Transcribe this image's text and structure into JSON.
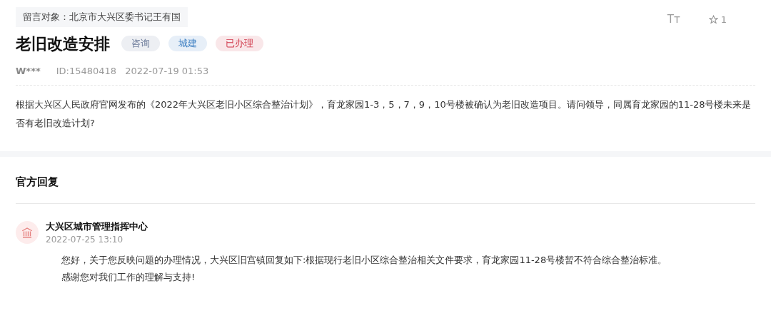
{
  "target": "留言对象：北京市大兴区委书记王有国",
  "toolbar": {
    "font_size": "Tт",
    "star_count": "1"
  },
  "title": "老旧改造安排",
  "tags": [
    {
      "label": "咨询",
      "color": "#6b7a99"
    },
    {
      "label": "城建",
      "color": "#3d7fc2"
    },
    {
      "label": "已办理",
      "color": "#d0384a"
    }
  ],
  "meta": {
    "user": "W***",
    "id": "ID:15480418",
    "time": "2022-07-19 01:53"
  },
  "body": "根据大兴区人民政府官网发布的《2022年大兴区老旧小区综合整治计划》，育龙家园1-3，5，7，9，10号楼被确认为老旧改造项目。请问领导，同属育龙家园的11-28号楼未来是否有老旧改造计划?",
  "reply_section": {
    "heading": "官方回复",
    "replies": [
      {
        "org": "大兴区城市管理指挥中心",
        "time": "2022-07-25 13:10",
        "paragraphs": [
          "您好，关于您反映问题的办理情况，大兴区旧宫镇回复如下:根据现行老旧小区综合整治相关文件要求，育龙家园11-28号楼暂不符合综合整治标准。",
          "感谢您对我们工作的理解与支持!"
        ]
      }
    ]
  }
}
